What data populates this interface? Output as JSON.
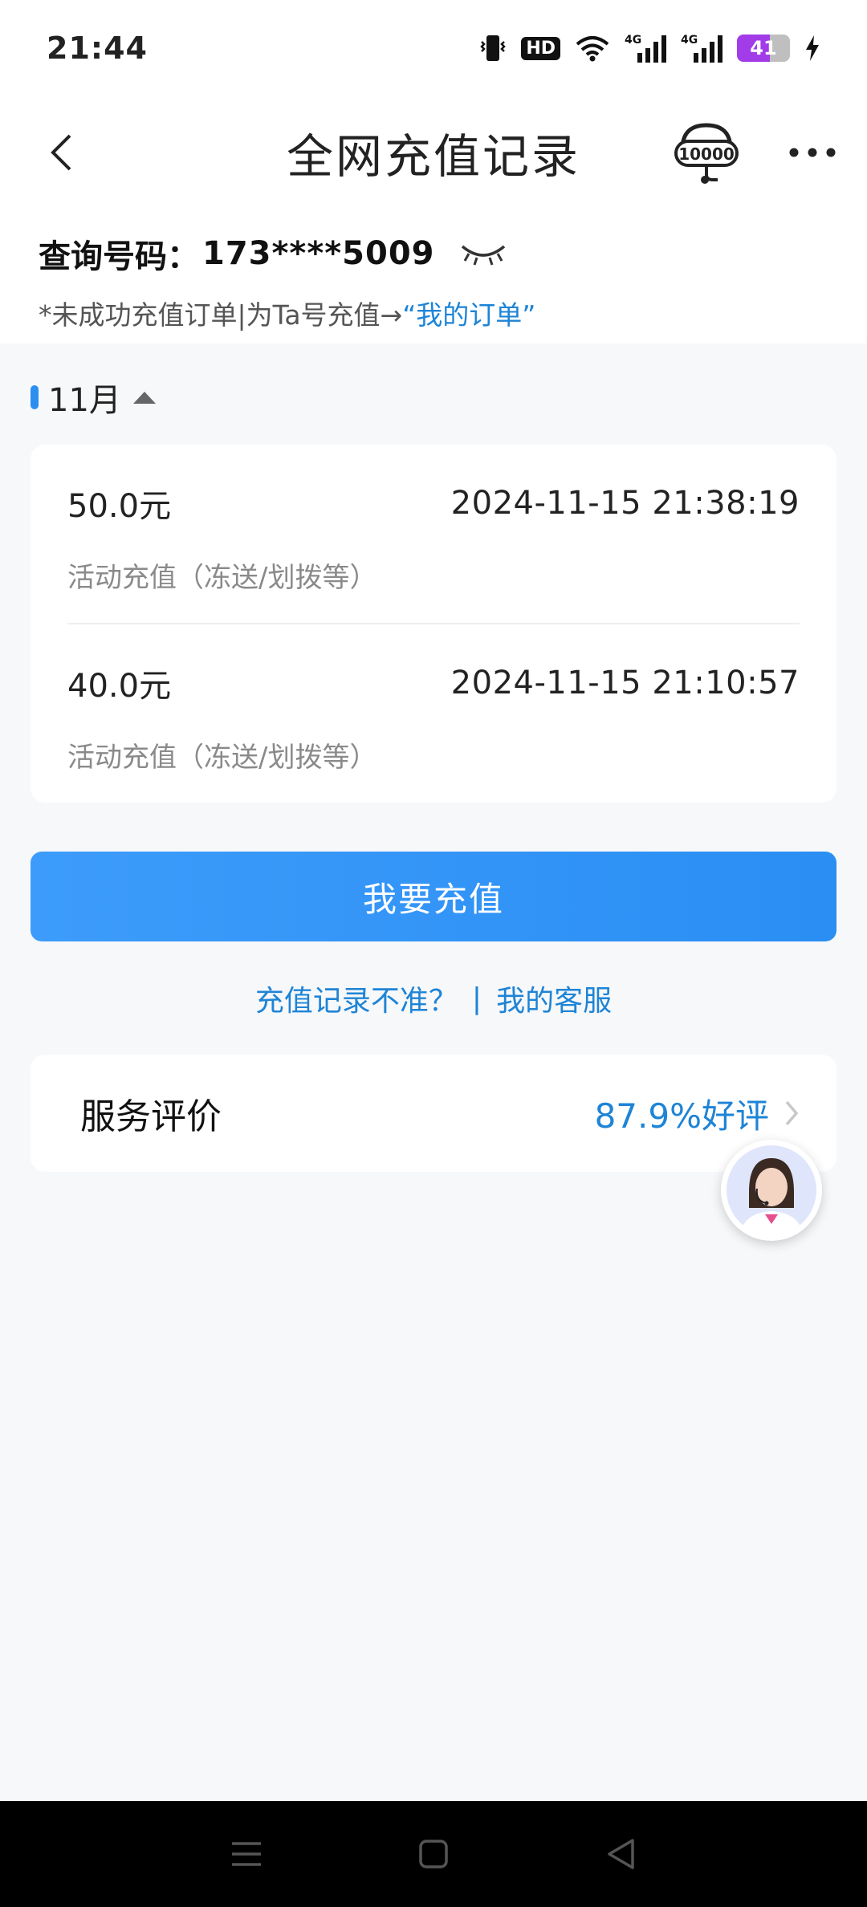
{
  "status_bar": {
    "time": "21:44",
    "hd_label": "HD",
    "battery_level": "41",
    "icons": [
      "vibrate-icon",
      "hd-voice-icon",
      "wifi-icon",
      "signal-4g-icon",
      "signal-4g-icon",
      "battery-icon",
      "charging-icon"
    ]
  },
  "header": {
    "title": "全网充值记录",
    "back_icon": "chevron-left-icon",
    "service_icon": "customer-service-10000-icon",
    "service_label": "10000",
    "more_icon": "more-dots-icon"
  },
  "info": {
    "query_label": "查询号码：",
    "query_number": "173****5009",
    "eye_icon": "eye-closed-icon",
    "hint_prefix": "*未成功充值订单|为Ta号充值→",
    "hint_link": "“我的订单”"
  },
  "month": {
    "label": "11月",
    "toggle_icon": "caret-up-icon"
  },
  "records": [
    {
      "amount": "50.0元",
      "time": "2024-11-15 21:38:19",
      "type": "活动充值（冻送/划拨等）"
    },
    {
      "amount": "40.0元",
      "time": "2024-11-15 21:10:57",
      "type": "活动充值（冻送/划拨等）"
    }
  ],
  "actions": {
    "recharge_label": "我要充值",
    "inaccurate_link": "充值记录不准？",
    "separator": "|",
    "service_link": "我的客服"
  },
  "rating": {
    "label": "服务评价",
    "value": "87.9%好评"
  },
  "colors": {
    "accent": "#2a8ef3",
    "link": "#1e84d6",
    "background": "#f7f8fa",
    "battery": "#a23be8"
  },
  "nav": {
    "icons": [
      "menu-icon",
      "home-square-icon",
      "back-triangle-icon"
    ]
  }
}
